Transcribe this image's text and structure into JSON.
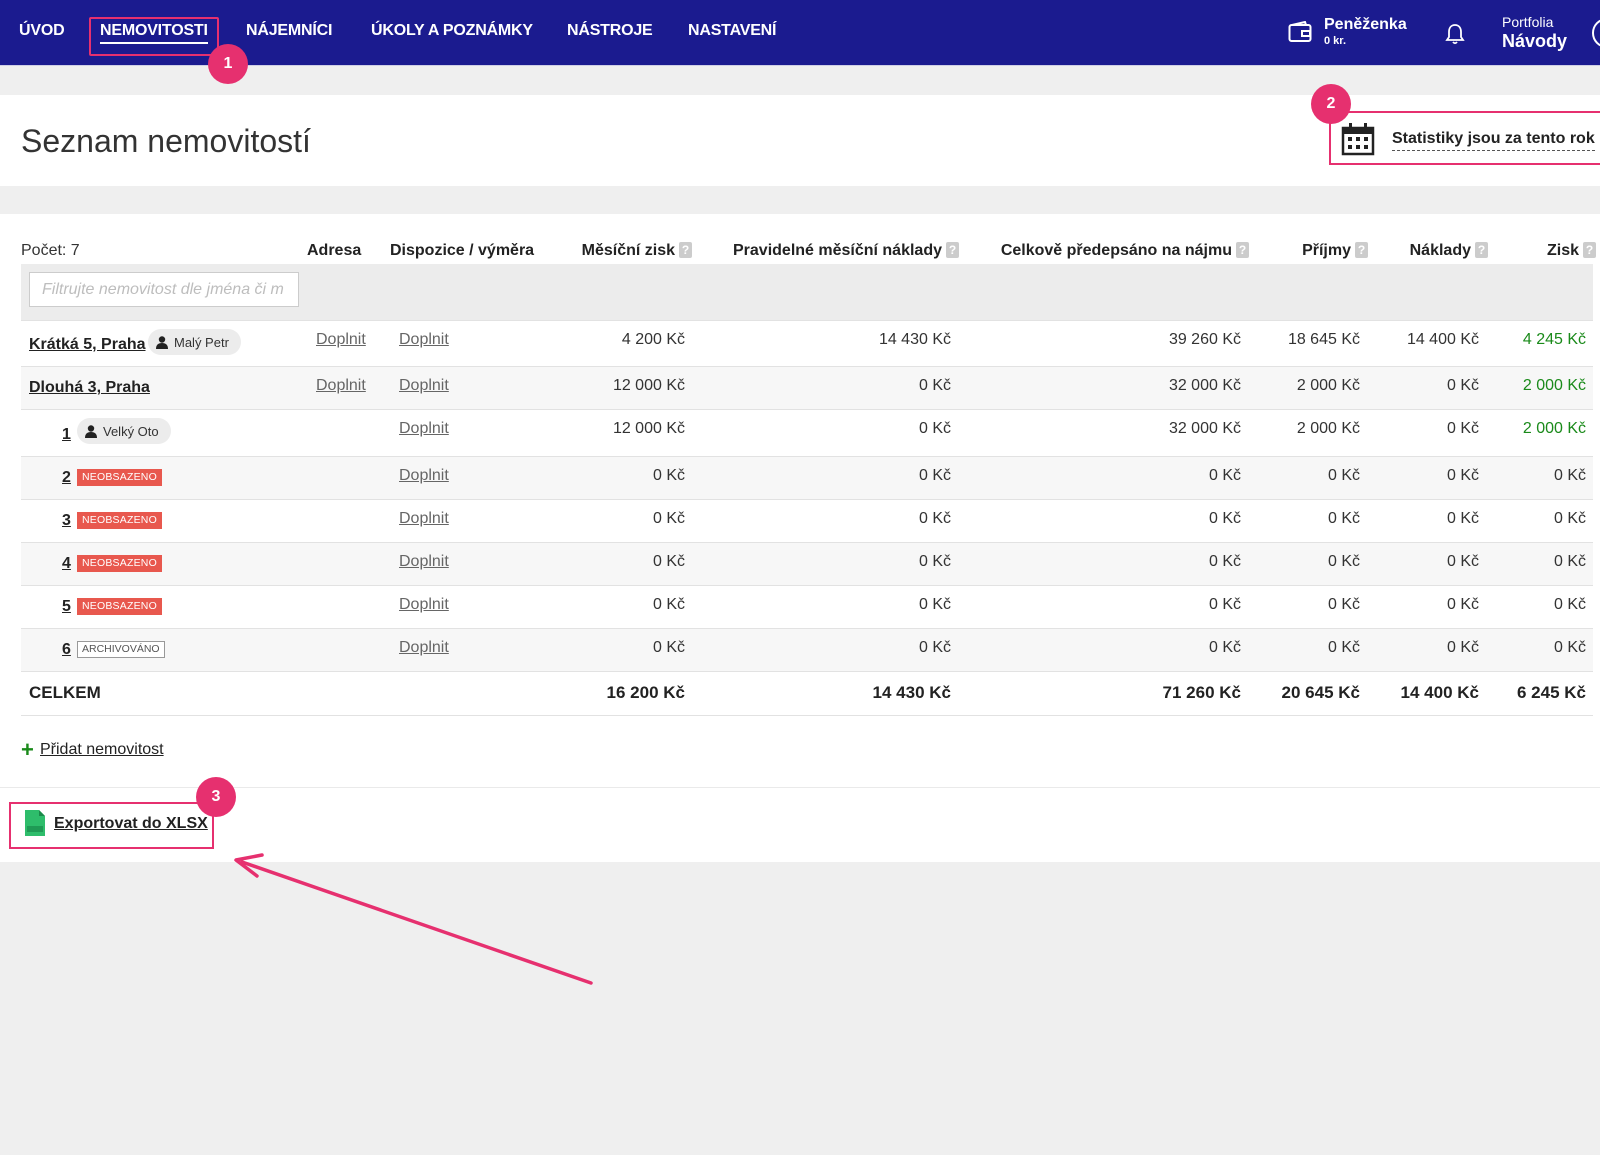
{
  "nav": {
    "items": [
      "ÚVOD",
      "NEMOVITOSTI",
      "NÁJEMNÍCI",
      "ÚKOLY A POZNÁMKY",
      "NÁSTROJE",
      "NASTAVENÍ"
    ],
    "wallet_title": "Peněženka",
    "wallet_amount": "0 kr.",
    "portfolio_label": "Portfolia",
    "portfolio_value": "Návody"
  },
  "markers": [
    "1",
    "2",
    "3"
  ],
  "header": {
    "title": "Seznam nemovitostí",
    "stats_link": "Statistiky jsou za tento rok"
  },
  "table": {
    "count_label": "Počet: 7",
    "columns": [
      "Adresa",
      "Dispozice / výměra",
      "Měsíční zisk",
      "Pravidelné měsíční náklady",
      "Celkově předepsáno na nájmu",
      "Příjmy",
      "Náklady",
      "Zisk"
    ],
    "help_glyph": "?",
    "filter_placeholder": "Filtrujte nemovitost dle jména či m",
    "rows": [
      {
        "name": "Krátká 5, Praha",
        "tenant": "Malý Petr",
        "address": "Doplnit",
        "disposition": "Doplnit",
        "monthly_profit": "4 200 Kč",
        "regular_costs": "14 430 Kč",
        "prescribed": "39 260 Kč",
        "income": "18 645 Kč",
        "costs": "14 400 Kč",
        "profit": "4 245 Kč"
      },
      {
        "name": "Dlouhá 3, Praha",
        "address": "Doplnit",
        "disposition": "Doplnit",
        "monthly_profit": "12 000 Kč",
        "regular_costs": "0 Kč",
        "prescribed": "32 000 Kč",
        "income": "2 000 Kč",
        "costs": "0 Kč",
        "profit": "2 000 Kč"
      },
      {
        "name": "1",
        "tenant": "Velký Oto",
        "disposition": "Doplnit",
        "monthly_profit": "12 000 Kč",
        "regular_costs": "0 Kč",
        "prescribed": "32 000 Kč",
        "income": "2 000 Kč",
        "costs": "0 Kč",
        "profit": "2 000 Kč"
      },
      {
        "name": "2",
        "badge": "NEOBSAZENO",
        "disposition": "Doplnit",
        "monthly_profit": "0 Kč",
        "regular_costs": "0 Kč",
        "prescribed": "0 Kč",
        "income": "0 Kč",
        "costs": "0 Kč",
        "profit": "0 Kč"
      },
      {
        "name": "3",
        "badge": "NEOBSAZENO",
        "disposition": "Doplnit",
        "monthly_profit": "0 Kč",
        "regular_costs": "0 Kč",
        "prescribed": "0 Kč",
        "income": "0 Kč",
        "costs": "0 Kč",
        "profit": "0 Kč"
      },
      {
        "name": "4",
        "badge": "NEOBSAZENO",
        "disposition": "Doplnit",
        "monthly_profit": "0 Kč",
        "regular_costs": "0 Kč",
        "prescribed": "0 Kč",
        "income": "0 Kč",
        "costs": "0 Kč",
        "profit": "0 Kč"
      },
      {
        "name": "5",
        "badge": "NEOBSAZENO",
        "disposition": "Doplnit",
        "monthly_profit": "0 Kč",
        "regular_costs": "0 Kč",
        "prescribed": "0 Kč",
        "income": "0 Kč",
        "costs": "0 Kč",
        "profit": "0 Kč"
      },
      {
        "name": "6",
        "badge": "ARCHIVOVÁNO",
        "disposition": "Doplnit",
        "monthly_profit": "0 Kč",
        "regular_costs": "0 Kč",
        "prescribed": "0 Kč",
        "income": "0 Kč",
        "costs": "0 Kč",
        "profit": "0 Kč"
      }
    ],
    "total": {
      "label": "CELKEM",
      "monthly_profit": "16 200 Kč",
      "regular_costs": "14 430 Kč",
      "prescribed": "71 260 Kč",
      "income": "20 645 Kč",
      "costs": "14 400 Kč",
      "profit": "6 245 Kč"
    }
  },
  "actions": {
    "add_property": "Přidat nemovitost",
    "export": "Exportovat do XLSX"
  },
  "colors": {
    "navbar": "#1b1b8f",
    "highlight": "#e6306f",
    "profit_green": "#1a8a1a",
    "badge_red": "#e8584e"
  }
}
